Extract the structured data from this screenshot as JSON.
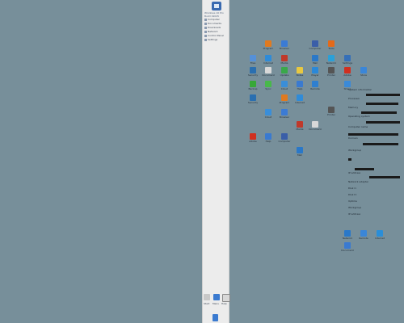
{
  "sidebar": {
    "header_lines": [
      "Windows 10 Pro",
      "Build 19045",
      "Desktop"
    ],
    "items": [
      {
        "label": "Computer"
      },
      {
        "label": "Documents"
      },
      {
        "label": "Downloads"
      },
      {
        "label": "Network"
      },
      {
        "label": "Control Panel"
      },
      {
        "label": "Settings"
      }
    ],
    "bottom_labels": [
      "Start",
      "Menu",
      "Help"
    ]
  },
  "desktop": {
    "icons": [
      {
        "name": "app-orange-icon",
        "label": "Program",
        "color": "#e07a20"
      },
      {
        "name": "app-blue-icon",
        "label": "Browser",
        "color": "#3b7bd4"
      },
      {
        "name": "app-computer-icon",
        "label": "Computer",
        "color": "#3a5ea8"
      },
      {
        "name": "app-orange2-icon",
        "label": "Tools",
        "color": "#e46a1a"
      },
      {
        "name": "app-folder-icon",
        "label": "Files",
        "color": "#5590d8"
      },
      {
        "name": "app-globe-icon",
        "label": "Internet",
        "color": "#2f8bd8"
      },
      {
        "name": "app-red-icon",
        "label": "Media",
        "color": "#c0392b"
      },
      {
        "name": "app-blue2-icon",
        "label": "Mail",
        "color": "#2a78c8"
      },
      {
        "name": "app-cyan-icon",
        "label": "Network",
        "color": "#2aa0d8"
      },
      {
        "name": "app-gear-icon",
        "label": "Settings",
        "color": "#3670b8"
      },
      {
        "name": "app-shield-icon",
        "label": "Security",
        "color": "#2a6fb0"
      },
      {
        "name": "app-doc-icon",
        "label": "Document",
        "color": "#d8d8d8"
      },
      {
        "name": "app-green-icon",
        "label": "Update",
        "color": "#3aa84a"
      },
      {
        "name": "app-note-icon",
        "label": "Notes",
        "color": "#e8c840"
      },
      {
        "name": "app-blue3-icon",
        "label": "Player",
        "color": "#2a88d8"
      },
      {
        "name": "app-printer-icon",
        "label": "Printer",
        "color": "#555555"
      },
      {
        "name": "app-red2-icon",
        "label": "Adobe",
        "color": "#d03020"
      },
      {
        "name": "app-blue4-icon",
        "label": "Store",
        "color": "#3a86d8"
      },
      {
        "name": "app-green2-icon",
        "label": "Backup",
        "color": "#38a838"
      },
      {
        "name": "app-green3-icon",
        "label": "Sync",
        "color": "#48b84a"
      },
      {
        "name": "app-blue5-icon",
        "label": "Cloud",
        "color": "#3a8ed8"
      },
      {
        "name": "app-blue6-icon",
        "label": "Help",
        "color": "#3a7ad0"
      },
      {
        "name": "app-blue7-icon",
        "label": "Remote",
        "color": "#2f7fd0"
      },
      {
        "name": "app-blue8-icon",
        "label": "Share",
        "color": "#3a8ad8"
      }
    ],
    "bottom_icons": [
      {
        "name": "lower-blue-icon",
        "label": "Network",
        "color": "#2a78c8"
      },
      {
        "name": "lower-blue2-icon",
        "label": "Remote",
        "color": "#3a86d8"
      },
      {
        "name": "lower-blue3-icon",
        "label": "Internet",
        "color": "#2a8ed8"
      },
      {
        "name": "lower-blue4-icon",
        "label": "Document",
        "color": "#3a7ad0"
      }
    ]
  },
  "info_panel": {
    "lines": [
      "System information",
      "Processor",
      "Memory",
      "Operating system",
      "Computer name",
      "Domain",
      "Workgroup",
      "IP address",
      "Network adapter",
      "Disk C:",
      "Disk D:",
      "Uptime"
    ]
  }
}
